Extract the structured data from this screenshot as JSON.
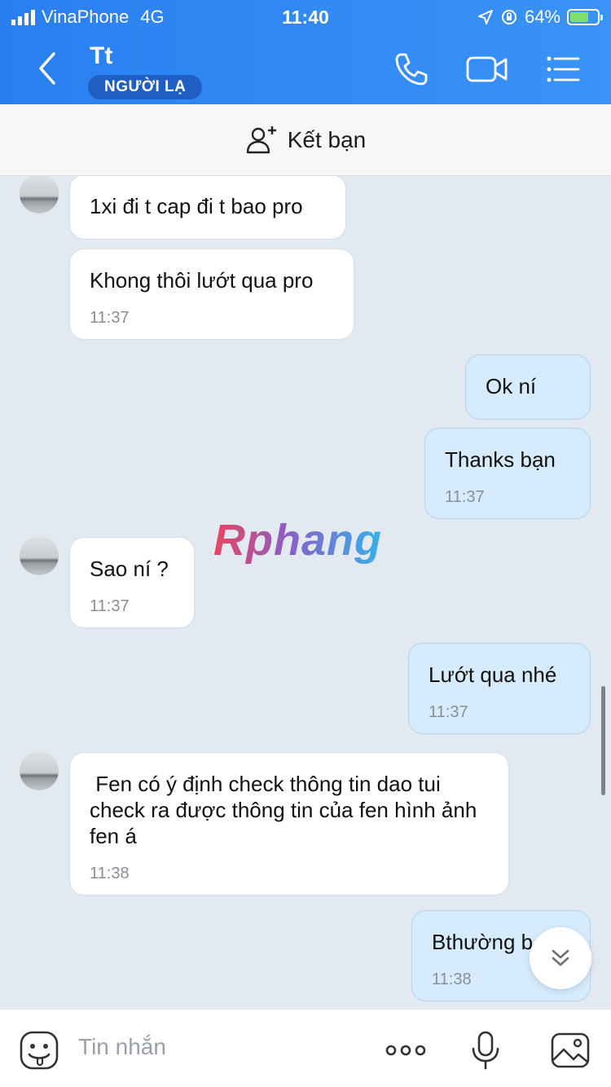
{
  "status_bar": {
    "carrier": "VinaPhone",
    "network": "4G",
    "time": "11:40",
    "battery": "64%"
  },
  "header": {
    "title": "Tt",
    "badge": "NGƯỜI LẠ"
  },
  "friend_bar": {
    "label": "Kết bạn"
  },
  "messages": [
    {
      "direction": "in",
      "text": "1xi đi t cap đi t bao pro",
      "time": ""
    },
    {
      "direction": "in",
      "text": "Khong thôi lướt qua pro",
      "time": "11:37"
    },
    {
      "direction": "out",
      "text": "Ok ní",
      "time": ""
    },
    {
      "direction": "out",
      "text": "Thanks bạn",
      "time": "11:37"
    },
    {
      "direction": "in",
      "text": "Sao ní ?",
      "time": "11:37"
    },
    {
      "direction": "out",
      "text": "Lướt qua nhé",
      "time": "11:37"
    },
    {
      "direction": "in",
      "text": " Fen có ý định check thông tin dao tui check ra được thông tin của fen hình ảnh fen á",
      "time": "11:38"
    },
    {
      "direction": "out",
      "text": "Bthường b",
      "time": "11:38"
    }
  ],
  "watermark": "Rphang",
  "input": {
    "placeholder": "Tin nhắn"
  },
  "colors": {
    "header": "#2a7ff0",
    "outgoing_bubble": "#d6ecfd",
    "incoming_bubble": "#ffffff",
    "chat_background": "#e2e9f1"
  }
}
